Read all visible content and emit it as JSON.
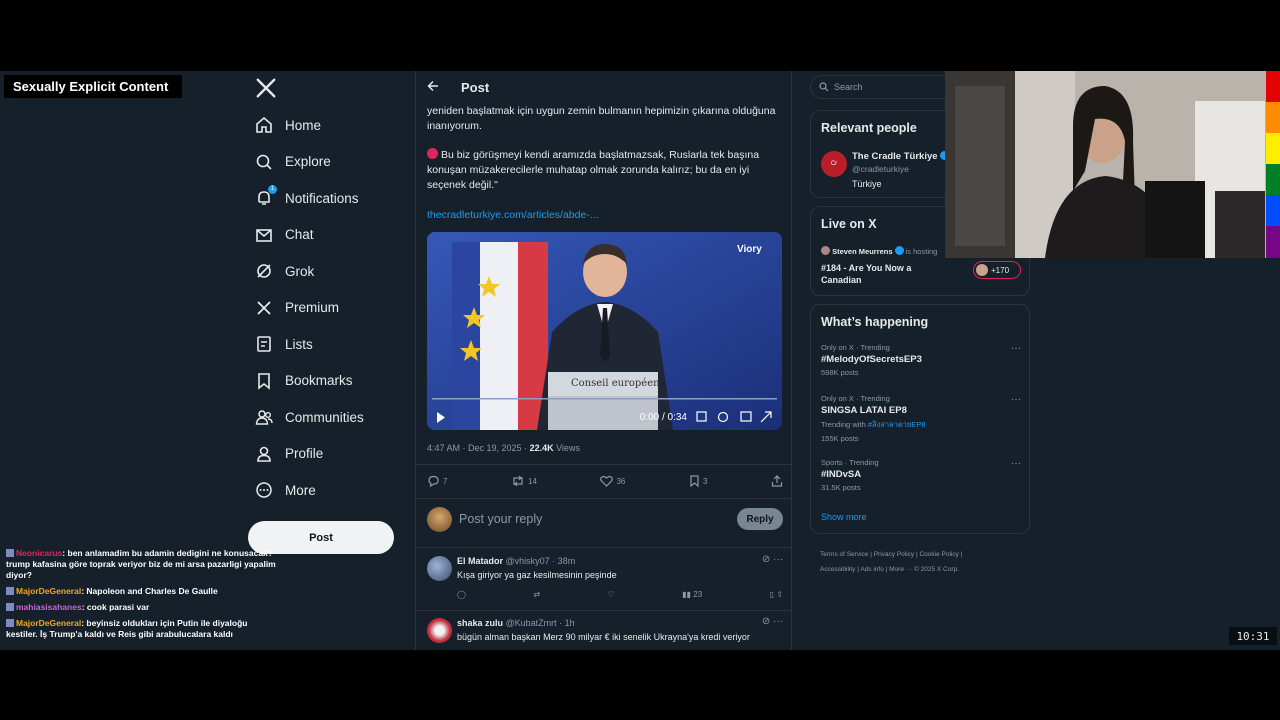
{
  "overlay": {
    "warning": "Sexually Explicit Content",
    "clock": "10:31"
  },
  "chat": [
    {
      "user": "Neonicarus",
      "user_color": "#e0245e",
      "text": "ben anlamadim bu adamin dedigini ne konusacak? trump kafasina göre toprak veriyor biz de mi arsa pazarligi yapalim diyor?"
    },
    {
      "user": "MajorDeGeneral",
      "user_color": "#f5a623",
      "text": "Napoleon and Charles De Gaulle"
    },
    {
      "user": "mahiasisahanes",
      "user_color": "#c964d6",
      "text": "cook parasi var"
    },
    {
      "user": "MajorDeGeneral",
      "user_color": "#f5a623",
      "text": "beyinsiz oldukları için Putin ile diyaloğu kestiler. İş Trump'a kaldı ve Reis gibi arabulucalara kaldı"
    }
  ],
  "nav": {
    "items": [
      {
        "label": "Home",
        "icon": "home-icon"
      },
      {
        "label": "Explore",
        "icon": "search-icon"
      },
      {
        "label": "Notifications",
        "icon": "bell-icon",
        "badge": "1"
      },
      {
        "label": "Chat",
        "icon": "mail-icon"
      },
      {
        "label": "Grok",
        "icon": "grok-icon"
      },
      {
        "label": "Premium",
        "icon": "x-icon"
      },
      {
        "label": "Lists",
        "icon": "list-icon"
      },
      {
        "label": "Bookmarks",
        "icon": "bookmark-icon"
      },
      {
        "label": "Communities",
        "icon": "people-icon"
      },
      {
        "label": "Profile",
        "icon": "person-icon"
      },
      {
        "label": "More",
        "icon": "more-icon"
      }
    ],
    "post_button": "Post"
  },
  "main": {
    "header_title": "Post",
    "text_line1": "yeniden başlatmak için uygun zemin bulmanın hepimizin çıkarına olduğuna inanıyorum.",
    "text_line2": "Bu biz görüşmeyi kendi aramızda başlatmazsak, Ruslarla tek başına konuşan müzakerecilerle muhatap olmak zorunda kalırız; bu da en iyi seçenek değil.\"",
    "link": "thecradleturkiye.com/articles/abde-...",
    "video": {
      "brand": "Viory",
      "podium_text": "Conseil européen",
      "time": "0:00 / 0:34"
    },
    "meta_time": "4:47 AM · Dec 19, 2025 · ",
    "meta_views": "22.4K",
    "meta_views_label": " Views",
    "stats": {
      "replies": "7",
      "reposts": "14",
      "likes": "36",
      "bookmarks": "3"
    },
    "reply_placeholder": "Post your reply",
    "reply_button": "Reply",
    "comments": [
      {
        "name": "El Matador",
        "handle": "@vhisky07 · 38m",
        "text": "Kışa giriyor ya gaz kesilmesinin peşinde",
        "views": "23"
      },
      {
        "name": "shaka zulu",
        "handle": "@KubatZmrt · 1h",
        "text": "bügün alman başkan Merz 90 milyar € iki senelik Ukrayna'ya kredi veriyor",
        "views": ""
      }
    ]
  },
  "right": {
    "search_placeholder": "Search",
    "relevant_title": "Relevant people",
    "relevant_name": "The Cradle Türkiye",
    "relevant_handle": "@cradleturkiye",
    "relevant_bio": "Türkiye",
    "live_title": "Live on X",
    "live_host": "Steven Meurrens",
    "live_host_suffix": "is hosting",
    "live_title_text": "#184 - Are You Now a Canadian",
    "live_count": "+170",
    "happening_title": "What’s happening",
    "trends": [
      {
        "context": "Only on X · Trending",
        "name": "#MelodyOfSecretsEP3",
        "extra": "",
        "posts": "598K posts"
      },
      {
        "context": "Only on X · Trending",
        "name": "SINGSA LATAI EP8",
        "extra_label": "Trending with ",
        "extra": "#สิงสาลาตายEP8",
        "posts": "155K posts"
      },
      {
        "context": "Sports · Trending",
        "name": "#INDvSA",
        "extra": "",
        "posts": "31.5K posts"
      }
    ],
    "show_more": "Show more",
    "footer_line1": "Terms of Service  |  Privacy Policy  |  Cookie Policy  |",
    "footer_line2": "Accessibility  |  Ads info  |  More ···  © 2025 X Corp."
  }
}
